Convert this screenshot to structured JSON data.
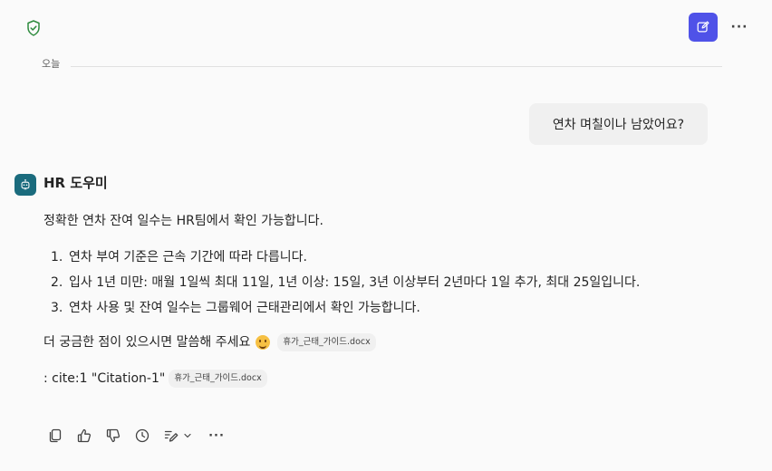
{
  "header": {
    "shield_icon": "shield-check-icon",
    "compose_icon": "compose-icon",
    "more_icon": "more-horizontal-icon",
    "more_label": "···",
    "accent_color": "#4f52e8"
  },
  "conversation": {
    "date_label": "오늘",
    "user_message": "연차 며칠이나 남았어요?",
    "bot": {
      "name": "HR 도우미",
      "avatar_icon": "bot-icon",
      "avatar_color": "#1a6b7d",
      "intro": "정확한 연차 잔여 일수는 HR팀에서 확인 가능합니다.",
      "list": [
        {
          "num": "1.",
          "text": "연차 부여 기준은 근속 기간에 따라 다릅니다."
        },
        {
          "num": "2.",
          "text": "입사 1년 미만: 매월 1일씩 최대 11일, 1년 이상: 15일, 3년 이상부터 2년마다 1일 추가, 최대 25일입니다."
        },
        {
          "num": "3.",
          "text": "연차 사용 및 잔여 일수는 그룹웨어 근태관리에서 확인 가능합니다."
        }
      ],
      "closing": "더 궁금한 점이 있으시면 말씀해 주세요",
      "closing_emoji": "smiling-face-icon",
      "source_chip": "휴가_근태_가이드.docx",
      "cite_text": ": cite:1 \"Citation-1\"",
      "cite_chip": "휴가_근태_가이드.docx"
    }
  },
  "actions": {
    "items": [
      "copy-icon",
      "thumbs-up-icon",
      "thumbs-down-icon",
      "history-icon",
      "edit-icon",
      "chevron-down-icon",
      "more-horizontal-icon"
    ],
    "more_label": "···"
  }
}
